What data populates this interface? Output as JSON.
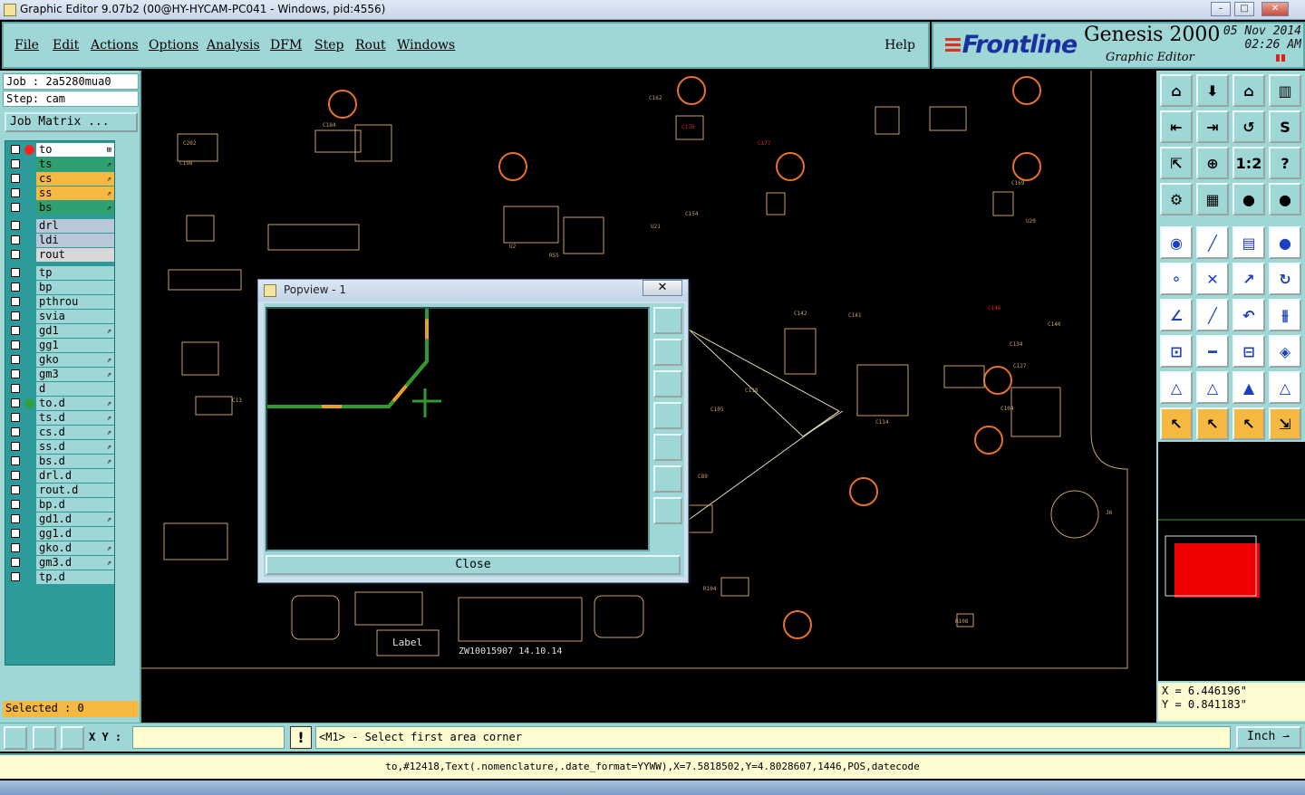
{
  "window": {
    "title": "Graphic Editor 9.07b2 (00@HY-HYCAM-PC041 - Windows, pid:4556)"
  },
  "menu": [
    "File",
    "Edit",
    "Actions",
    "Options",
    "Analysis",
    "DFM",
    "Step",
    "Rout",
    "Windows"
  ],
  "help_label": "Help",
  "brand": {
    "logo": "Frontline",
    "product": "Genesis 2000",
    "subtitle": "Graphic Editor",
    "date": "05 Nov 2014",
    "time": "02:26 AM"
  },
  "job": {
    "job_label": "Job : 2a5280mua0",
    "step_label": "Step: cam",
    "matrix_button": "Job Matrix ..."
  },
  "layers": [
    {
      "name": "to",
      "bg": "#ffffff",
      "dot": "#ff2020",
      "flag": "⊞"
    },
    {
      "name": "ts",
      "bg": "#2fa070",
      "flag": "⇗"
    },
    {
      "name": "cs",
      "bg": "#f5b840",
      "flag": "⇗"
    },
    {
      "name": "ss",
      "bg": "#f5b840",
      "flag": "⇗"
    },
    {
      "name": "bs",
      "bg": "#2fa070",
      "flag": "⇗"
    },
    {
      "name": "drl",
      "bg": "#b8c8d8",
      "gap": true
    },
    {
      "name": "ldi",
      "bg": "#b8c8d8"
    },
    {
      "name": "rout",
      "bg": "#d8d8d8"
    },
    {
      "name": "tp",
      "bg": "#9fd6d6",
      "gap": true
    },
    {
      "name": "bp",
      "bg": "#9fd6d6"
    },
    {
      "name": "pthrou",
      "bg": "#9fd6d6"
    },
    {
      "name": "svia",
      "bg": "#9fd6d6"
    },
    {
      "name": "gd1",
      "bg": "#9fd6d6",
      "flag": "⇗"
    },
    {
      "name": "gg1",
      "bg": "#9fd6d6"
    },
    {
      "name": "gko",
      "bg": "#9fd6d6",
      "flag": "⇗"
    },
    {
      "name": "gm3",
      "bg": "#9fd6d6",
      "flag": "⇗"
    },
    {
      "name": "d",
      "bg": "#9fd6d6"
    },
    {
      "name": "to.d",
      "bg": "#9fd6d6",
      "dot": "#2fa040",
      "flag": "⇗"
    },
    {
      "name": "ts.d",
      "bg": "#9fd6d6",
      "flag": "⇗"
    },
    {
      "name": "cs.d",
      "bg": "#9fd6d6",
      "flag": "⇗"
    },
    {
      "name": "ss.d",
      "bg": "#9fd6d6",
      "flag": "⇗"
    },
    {
      "name": "bs.d",
      "bg": "#9fd6d6",
      "flag": "⇗"
    },
    {
      "name": "drl.d",
      "bg": "#9fd6d6"
    },
    {
      "name": "rout.d",
      "bg": "#9fd6d6"
    },
    {
      "name": "bp.d",
      "bg": "#9fd6d6"
    },
    {
      "name": "gd1.d",
      "bg": "#9fd6d6",
      "flag": "⇗"
    },
    {
      "name": "gg1.d",
      "bg": "#9fd6d6"
    },
    {
      "name": "gko.d",
      "bg": "#9fd6d6",
      "flag": "⇗"
    },
    {
      "name": "gm3.d",
      "bg": "#9fd6d6",
      "flag": "⇗"
    },
    {
      "name": "tp.d",
      "bg": "#9fd6d6"
    }
  ],
  "selected_label": "Selected : 0",
  "coords": {
    "x": "X = 6.446196\"",
    "y": "Y = 0.841183\""
  },
  "xy_label": "X Y :",
  "bang": "!",
  "prompt": "<M1> - Select first area corner",
  "unit": "Inch",
  "status": "to,#12418,Text(.nomenclature,.date_format=YYWW),X=7.5818502,Y=4.8028607,1446,POS,datecode",
  "popup": {
    "title": "Popview - 1",
    "close_x": "✕",
    "close_button": "Close"
  },
  "board_labels": {
    "label_box": "Label",
    "code": "ZW10015907 14.10.14"
  },
  "colors": {
    "panel": "#9fd6d6",
    "trace": "#e8b84a",
    "route": "#2fa040",
    "pad": "#e8702a"
  }
}
